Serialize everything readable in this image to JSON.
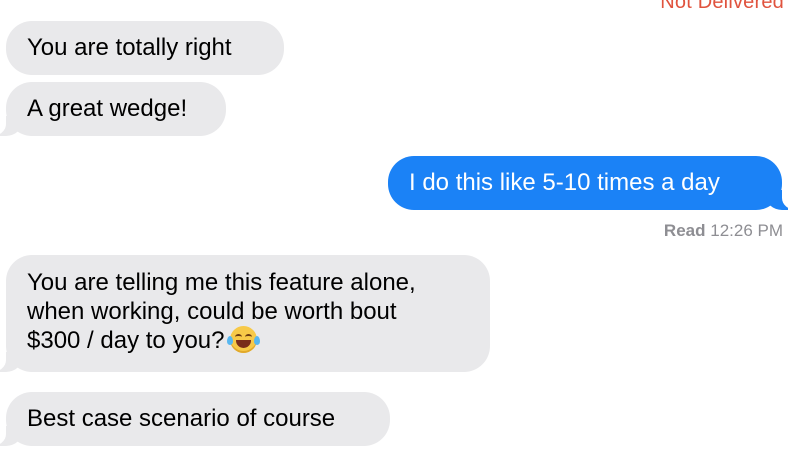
{
  "top_status": "Not Delivered",
  "messages": [
    {
      "text": "You are totally right"
    },
    {
      "text": "A great wedge!"
    },
    {
      "text": "I do this like 5-10 times a day"
    },
    {
      "line1": "You are telling me this feature alone,",
      "line2": "when working, could be worth bout",
      "line3": "$300 / day to you?"
    },
    {
      "text": "Best case scenario of course"
    }
  ],
  "receipt": {
    "label": "Read",
    "time": "12:26 PM"
  },
  "icons": {
    "emoji": "face-with-tears-of-joy-icon"
  },
  "colors": {
    "incoming": "#e9e9eb",
    "outgoing": "#1b82f6",
    "error": "#e0533e",
    "receipt": "#8e8e93"
  }
}
